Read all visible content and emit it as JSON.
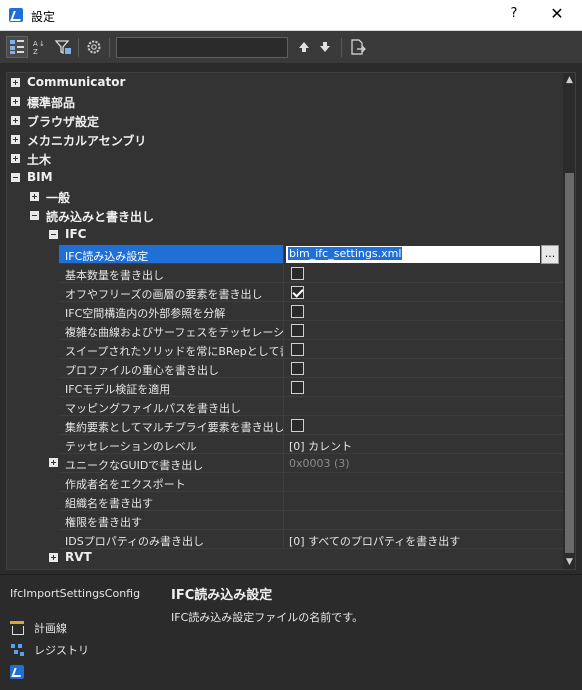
{
  "window": {
    "title": "設定",
    "help": "?",
    "close": "✕"
  },
  "toolbar": {
    "search_value": ""
  },
  "tree": {
    "communicator": "Communicator",
    "hyojun": "標準部品",
    "browser": "ブラウザ設定",
    "mechanical": "メカニカルアセンブリ",
    "civil": "土木",
    "bim": "BIM",
    "general": "一般",
    "import_export": "読み込みと書き出し",
    "ifc": "IFC",
    "rvt": "RVT"
  },
  "props": [
    {
      "name": "IFC読み込み設定",
      "value": "bim_ifc_settings.xml",
      "kind": "file"
    },
    {
      "name": "基本数量を書き出し",
      "checked": false,
      "kind": "check"
    },
    {
      "name": "オフやフリーズの画層の要素を書き出し",
      "checked": true,
      "kind": "check"
    },
    {
      "name": "IFC空間構造内の外部参照を分解",
      "checked": false,
      "kind": "check"
    },
    {
      "name": "複雑な曲線およびサーフェスをテッセレーション",
      "checked": false,
      "kind": "check"
    },
    {
      "name": "スイープされたソリッドを常にBRepとして書き出す",
      "checked": false,
      "kind": "check"
    },
    {
      "name": "プロファイルの重心を書き出し",
      "checked": false,
      "kind": "check"
    },
    {
      "name": "IFCモデル検証を適用",
      "checked": false,
      "kind": "check"
    },
    {
      "name": "マッピングファイルパスを書き出し",
      "value": "",
      "kind": "text"
    },
    {
      "name": "集約要素としてマルチプライ要素を書き出し",
      "checked": false,
      "kind": "check"
    },
    {
      "name": "テッセレーションのレベル",
      "value": "[0] カレント",
      "kind": "text"
    },
    {
      "name": "ユニークなGUIDで書き出し",
      "value": "0x0003 (3)",
      "kind": "disabled"
    },
    {
      "name": "作成者名をエクスポート",
      "value": "",
      "kind": "text"
    },
    {
      "name": "組織名を書き出す",
      "value": "",
      "kind": "text"
    },
    {
      "name": "権限を書き出す",
      "value": "",
      "kind": "text"
    },
    {
      "name": "IDSプロパティのみ書き出し",
      "value": "[0] すべてのプロパティを書き出す",
      "kind": "text"
    }
  ],
  "ellipsis": "...",
  "description": {
    "key": "IfcImportSettingsConfig",
    "title": "IFC読み込み設定",
    "text": "IFC読み込み設定ファイルの名前です。"
  },
  "side": {
    "plan": "計画線",
    "registry": "レジストリ"
  },
  "icons": {
    "app": "bricscad-icon",
    "tree_view": "tree-view-icon",
    "sort_az": "sort-az-icon",
    "filter": "filter-icon",
    "settings": "gear-icon",
    "up": "arrow-up-icon",
    "down": "arrow-down-icon",
    "export": "export-icon"
  },
  "colors": {
    "accent": "#1f6fd6",
    "background": "#2b2b2b",
    "grid": "#333333"
  }
}
